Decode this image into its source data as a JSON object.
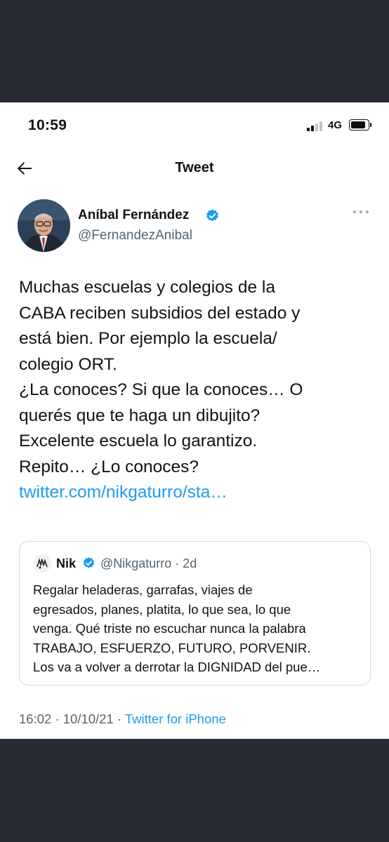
{
  "status_bar": {
    "time": "10:59",
    "network": "4G"
  },
  "nav": {
    "title": "Tweet"
  },
  "author": {
    "name": "Aníbal Fernández",
    "handle": "@FernandezAnibal"
  },
  "tweet": {
    "text_lines": [
      "Muchas escuelas y colegios de la",
      "CABA reciben subsidios del estado y",
      "está bien. Por ejemplo la escuela/",
      "colegio ORT.",
      "¿La conoces? Si que la conoces… O",
      "querés que te haga un dibujito?",
      "Excelente escuela lo garantizo.",
      "Repito… ¿Lo conoces?"
    ],
    "link": "twitter.com/nikgaturro/sta…"
  },
  "quote": {
    "name": "Nik",
    "handle_time": "@Nikgaturro · 2d",
    "text_lines": [
      "Regalar heladeras, garrafas, viajes de",
      "egresados, planes, platita, lo que sea, lo que",
      "venga. Qué triste no escuchar nunca la palabra",
      "TRABAJO, ESFUERZO, FUTURO, PORVENIR.",
      "Los va a volver a derrotar la DIGNIDAD del pue…"
    ]
  },
  "meta": {
    "timestamp": "16:02 · 10/10/21 · ",
    "source": "Twitter for iPhone"
  },
  "icons": {
    "back": "arrow-left-icon",
    "verified": "verified-badge-icon",
    "more": "more-horizontal-icon",
    "signal": "cellular-signal-icon",
    "battery": "battery-icon"
  },
  "colors": {
    "accent": "#1d9bf0",
    "secondary_text": "#536471",
    "primary_text": "#0f1419",
    "border": "#cfd9de",
    "letterbox": "#272a33"
  }
}
